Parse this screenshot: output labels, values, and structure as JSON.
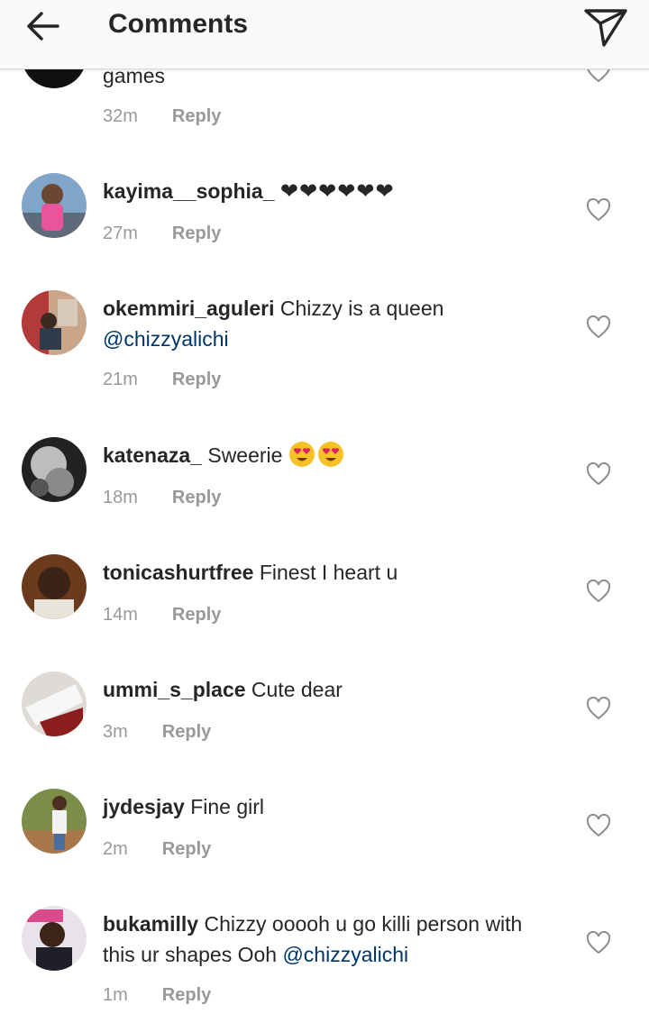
{
  "header": {
    "title": "Comments",
    "back_icon": "arrow-left-icon",
    "send_icon": "paper-plane-icon"
  },
  "reply_label": "Reply",
  "comments": [
    {
      "username": "",
      "text": "games",
      "time": "32m"
    },
    {
      "username": "kayima__sophia_",
      "text": "❤❤❤❤❤❤",
      "time": "27m"
    },
    {
      "username": "okemmiri_aguleri",
      "text": "Chizzy is a queen",
      "mention": "@chizzyalichi",
      "time": "21m"
    },
    {
      "username": "katenaza_",
      "text": "Sweerie",
      "emoji": "smiling-face-heart-eyes",
      "time": "18m"
    },
    {
      "username": "tonicashurtfree",
      "text": "Finest I heart u",
      "time": "14m"
    },
    {
      "username": "ummi_s_place",
      "text": "Cute dear",
      "time": "3m"
    },
    {
      "username": "jydesjay",
      "text": "Fine girl",
      "time": "2m"
    },
    {
      "username": "bukamilly",
      "text": "Chizzy ooooh u go killi person with",
      "text2": "this ur shapes Ooh",
      "mention": "@chizzyalichi",
      "time": "1m"
    }
  ],
  "colors": {
    "mention": "#003569",
    "meta": "#999999",
    "text": "#262626",
    "header_bg": "#fafafa"
  }
}
